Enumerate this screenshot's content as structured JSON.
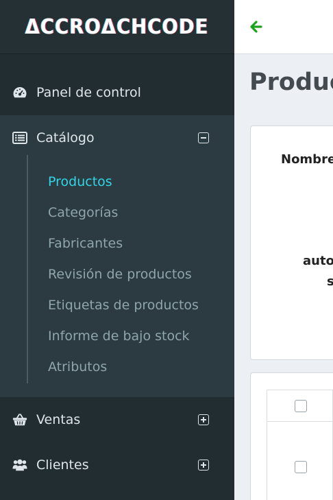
{
  "brand": {
    "logo_text": "ΔCCROΔCHCODE"
  },
  "sidebar": {
    "dashboard": {
      "label": "Panel de control",
      "icon": "dashboard-gauge-icon"
    },
    "catalog": {
      "label": "Catálogo",
      "icon": "list-icon",
      "expanded": true,
      "items": [
        {
          "label": "Productos",
          "active": true
        },
        {
          "label": "Categorías",
          "active": false
        },
        {
          "label": "Fabricantes",
          "active": false
        },
        {
          "label": "Revisión de productos",
          "active": false
        },
        {
          "label": "Etiquetas de productos",
          "active": false
        },
        {
          "label": "Informe de bajo stock",
          "active": false
        },
        {
          "label": "Atributos",
          "active": false
        }
      ]
    },
    "sales": {
      "label": "Ventas",
      "icon": "basket-icon",
      "expanded": false
    },
    "customers": {
      "label": "Clientes",
      "icon": "users-icon",
      "expanded": false
    }
  },
  "main": {
    "title": "Product",
    "search_card": {
      "column_label": "Nombre",
      "fragment_1": "autor",
      "fragment_2": "s"
    }
  },
  "colors": {
    "sidebar_bg": "#222d32",
    "submenu_bg": "#2c3b41",
    "active_link": "#31d6e6",
    "back_arrow": "#1aa31a"
  }
}
